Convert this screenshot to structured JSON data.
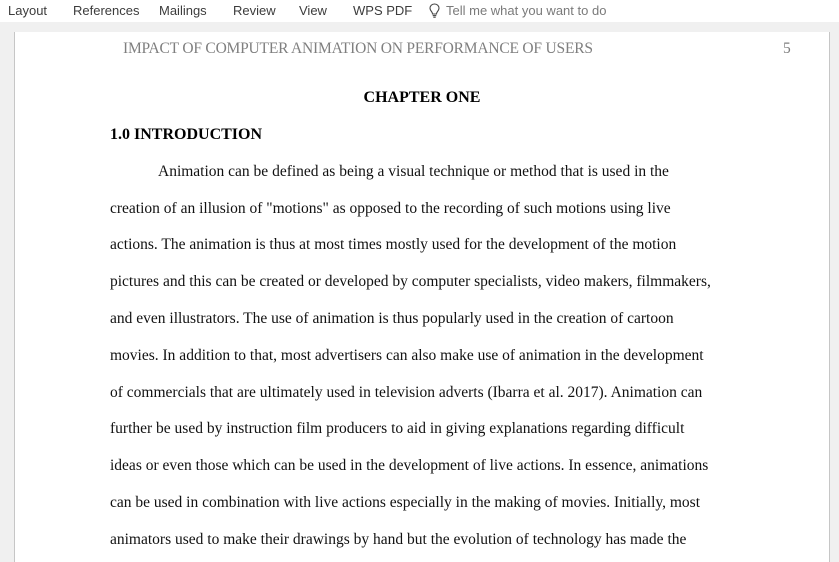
{
  "ribbon": {
    "tabs": [
      {
        "label": "Layout"
      },
      {
        "label": "References"
      },
      {
        "label": "Mailings"
      },
      {
        "label": "Review"
      },
      {
        "label": "View"
      },
      {
        "label": "WPS PDF"
      }
    ],
    "tell_me": {
      "icon": "lightbulb-icon",
      "placeholder": "Tell me what you want to do"
    }
  },
  "document": {
    "running_header": "IMPACT OF COMPUTER ANIMATION ON PERFORMANCE OF USERS",
    "page_number": "5",
    "chapter_title": "CHAPTER ONE",
    "section_heading": "1.0 INTRODUCTION",
    "body_lines": [
      "Animation can be defined as being a visual technique or method that is used in the",
      "creation of an illusion of \"motions\" as opposed to the recording of such motions using live",
      "actions. The animation is thus at most times mostly used for the development of the motion",
      "pictures and this can be created or developed by computer specialists, video makers, filmmakers,",
      "and even illustrators. The use of animation is thus popularly used in the creation of cartoon",
      "movies. In addition to that, most advertisers can also make use of animation in the development",
      "of commercials that are ultimately used in television adverts (Ibarra et al. 2017). Animation can",
      "further be used by instruction film producers to aid in giving explanations regarding difficult",
      "ideas or even those which can be used in the development of live actions. In essence, animations",
      "can be used in combination with live actions especially in the making of movies. Initially, most",
      "animators used to make their drawings by hand but the evolution of technology has made the"
    ]
  }
}
